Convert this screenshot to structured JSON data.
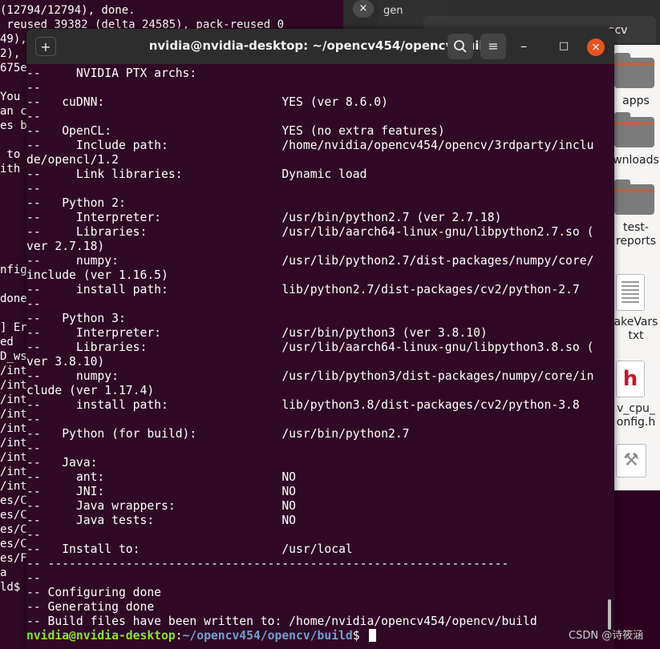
{
  "bg_terminal": {
    "lines": [
      "(12794/12794), done.",
      " reused 39382 (delta 24585), pack-reused 0",
      "49),",
      "2),",
      "675e",
      "",
      "You",
      "an c",
      "es b",
      "",
      " to",
      "ith",
      "",
      "",
      "",
      "",
      "",
      "",
      "nfig",
      "",
      "done",
      "",
      "] Er",
      "ed",
      "D_ws",
      "/int",
      "/int",
      "/int",
      "/int",
      "/int",
      "/int",
      "/int",
      "/int",
      "/int",
      "es/C",
      "es/C",
      "es/C",
      "es/C",
      "es/F",
      "a",
      "ld$"
    ]
  },
  "file_manager": {
    "close_label": "×",
    "tab1_label": "gen",
    "tab2_label": "ecv",
    "items": [
      {
        "label": "apps",
        "icon": "folder-icon"
      },
      {
        "label": "wnloads",
        "icon": "folder-icon"
      },
      {
        "label": "test-\nreports",
        "icon": "folder-icon"
      },
      {
        "label": "akeVars\ntxt",
        "icon": "text-file-icon"
      },
      {
        "label": "v_cpu_\nonfig.h",
        "icon": "header-file-icon"
      },
      {
        "label": "",
        "icon": "build-tool-icon"
      }
    ]
  },
  "window": {
    "title": "nvidia@nvidia-desktop: ~/opencv454/opencv/build",
    "newtab_icon": "+",
    "menu_icon": "≡",
    "minimize_icon": "–",
    "maximize_icon": "□",
    "close_icon": "×"
  },
  "terminal": {
    "lines": [
      "--     NVIDIA PTX archs:",
      "--",
      "--   cuDNN:                         YES (ver 8.6.0)",
      "--",
      "--   OpenCL:                        YES (no extra features)",
      "--     Include path:                /home/nvidia/opencv454/opencv/3rdparty/inclu",
      "de/opencl/1.2",
      "--     Link libraries:              Dynamic load",
      "--",
      "--   Python 2:",
      "--     Interpreter:                 /usr/bin/python2.7 (ver 2.7.18)",
      "--     Libraries:                   /usr/lib/aarch64-linux-gnu/libpython2.7.so (",
      "ver 2.7.18)",
      "--     numpy:                       /usr/lib/python2.7/dist-packages/numpy/core/",
      "include (ver 1.16.5)",
      "--     install path:                lib/python2.7/dist-packages/cv2/python-2.7",
      "--",
      "--   Python 3:",
      "--     Interpreter:                 /usr/bin/python3 (ver 3.8.10)",
      "--     Libraries:                   /usr/lib/aarch64-linux-gnu/libpython3.8.so (",
      "ver 3.8.10)",
      "--     numpy:                       /usr/lib/python3/dist-packages/numpy/core/in",
      "clude (ver 1.17.4)",
      "--     install path:                lib/python3.8/dist-packages/cv2/python-3.8",
      "--",
      "--   Python (for build):            /usr/bin/python2.7",
      "--",
      "--   Java:",
      "--     ant:                         NO",
      "--     JNI:                         NO",
      "--     Java wrappers:               NO",
      "--     Java tests:                  NO",
      "--",
      "--   Install to:                    /usr/local",
      "-- -----------------------------------------------------------------",
      "--",
      "-- Configuring done",
      "-- Generating done",
      "-- Build files have been written to: /home/nvidia/opencv454/opencv/build"
    ],
    "prompt_user": "nvidia@nvidia-desktop",
    "prompt_sep": ":",
    "prompt_path": "~/opencv454/opencv/build",
    "prompt_end": "$ "
  },
  "watermark": "CSDN @诗筱涵"
}
